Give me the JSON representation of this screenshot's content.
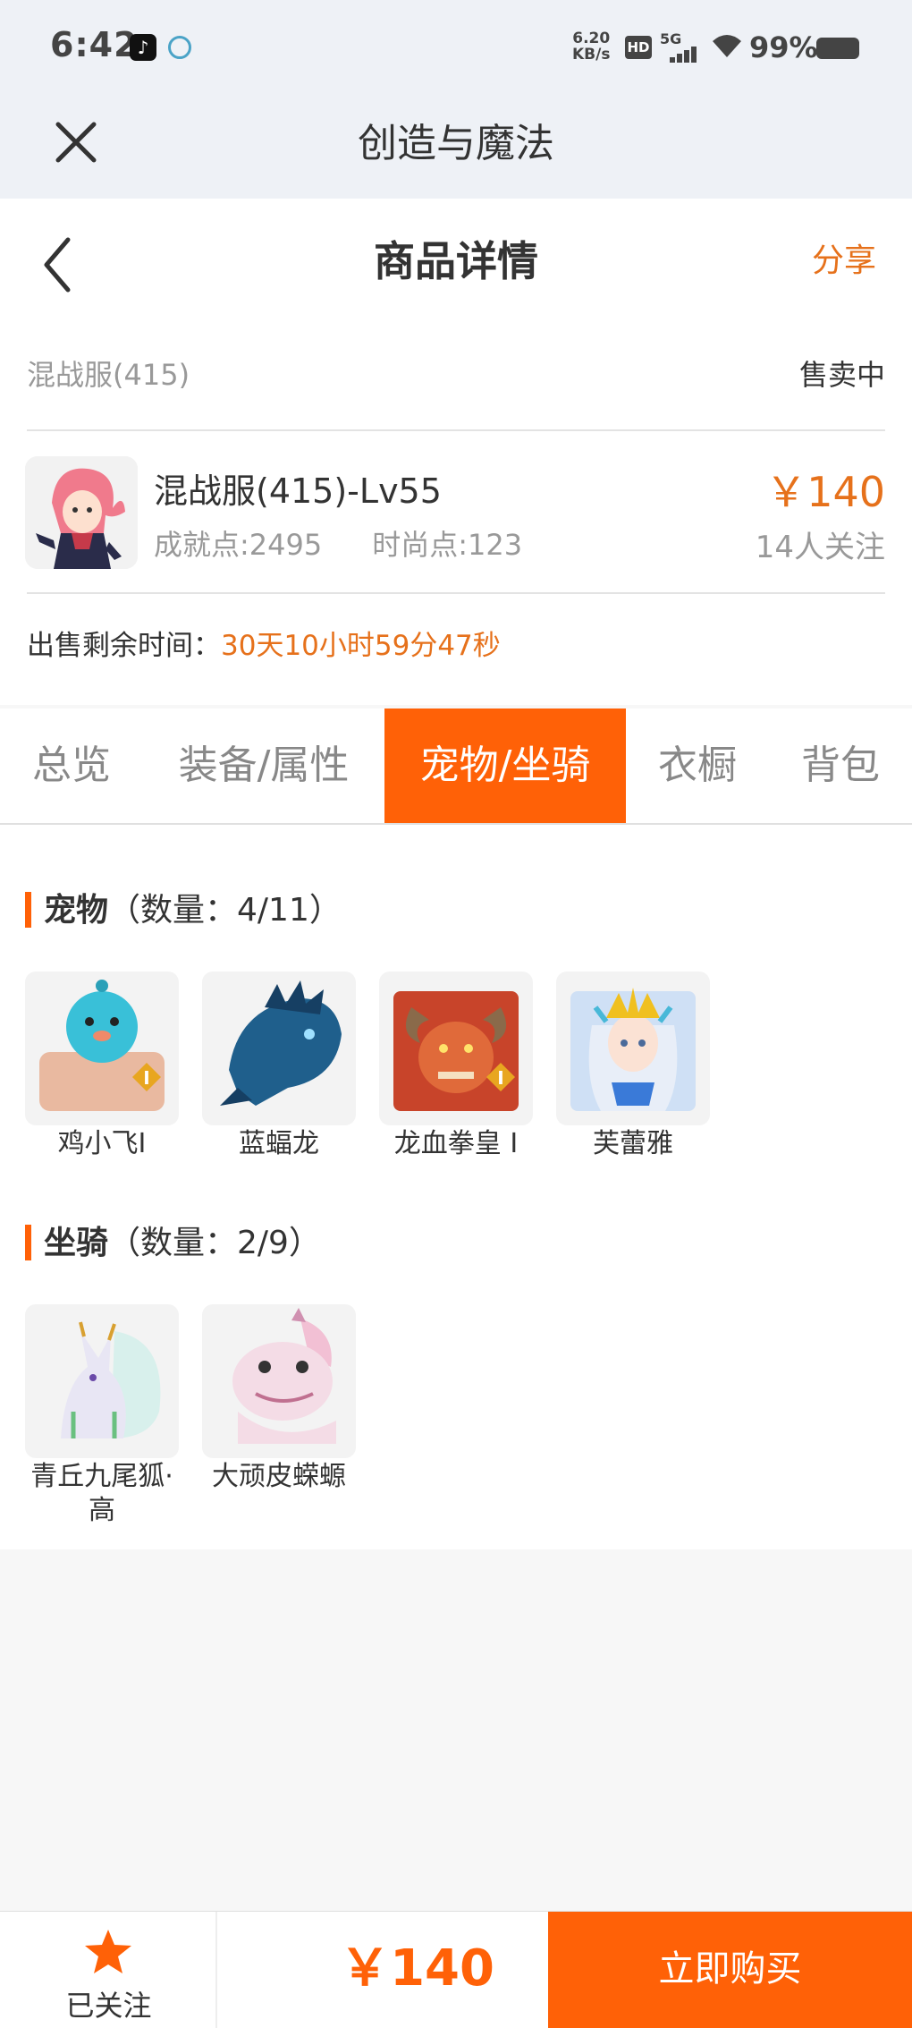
{
  "status": {
    "time": "6:42",
    "tiktok_icon": "tiktok-icon",
    "net_speed_value": "6.20",
    "net_speed_unit": "KB/s",
    "hd": "HD",
    "network": "5G",
    "battery": "99%"
  },
  "app": {
    "title": "创造与魔法"
  },
  "header": {
    "title": "商品详情",
    "share": "分享"
  },
  "listing": {
    "server": "混战服(415)",
    "state": "售卖中",
    "char_name": "混战服(415)-Lv55",
    "achievement": "成就点:2495",
    "fashion": "时尚点:123",
    "price": "￥140",
    "watchers": "14人关注",
    "remain_label": "出售剩余时间：",
    "remain_value": "30天10小时59分47秒"
  },
  "tabs": [
    "总览",
    "装备/属性",
    "宠物/坐骑",
    "衣橱",
    "背包"
  ],
  "active_tab": "宠物/坐骑",
  "pets": {
    "title": "宠物",
    "count": "（数量：4/11）",
    "items": [
      {
        "name": "鸡小飞I",
        "badge": "I"
      },
      {
        "name": "蓝蝠龙"
      },
      {
        "name": "龙血拳皇 I",
        "badge": "I"
      },
      {
        "name": "芙蕾雅"
      }
    ]
  },
  "mounts": {
    "title": "坐骑",
    "count": "（数量：2/9）",
    "items": [
      {
        "name": "青丘九尾狐·高"
      },
      {
        "name": "大顽皮蝾螈"
      }
    ]
  },
  "bottom": {
    "follow": "已关注",
    "price": "￥140",
    "buy": "立即购买"
  },
  "colors": {
    "accent": "#ff6107",
    "price": "#e6711b"
  }
}
